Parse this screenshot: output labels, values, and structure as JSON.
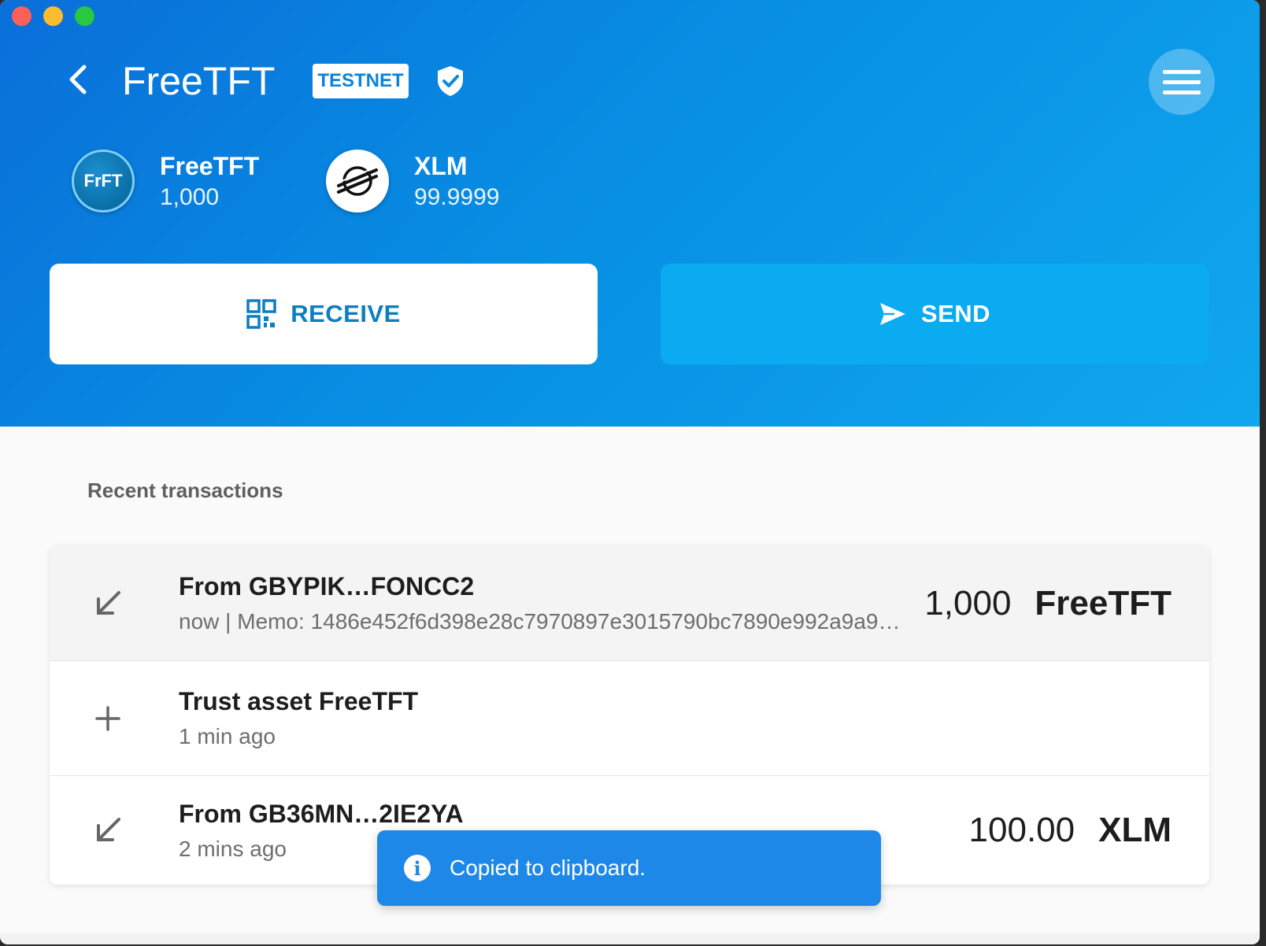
{
  "window": {
    "traffic_lights": [
      "close",
      "minimize",
      "maximize"
    ]
  },
  "header": {
    "title": "FreeTFT",
    "network_badge": "TESTNET",
    "back_icon": "chevron-left-icon",
    "verified_icon": "shield-check-icon",
    "menu_icon": "hamburger-icon"
  },
  "balances": [
    {
      "coin_label": "FrFT",
      "code": "FreeTFT",
      "amount": "1,000"
    },
    {
      "coin_label": "",
      "code": "XLM",
      "amount": "99.9999",
      "icon": "stellar-logo-icon"
    }
  ],
  "actions": {
    "receive_label": "RECEIVE",
    "receive_icon": "qr-code-icon",
    "send_label": "SEND",
    "send_icon": "send-icon"
  },
  "transactions": {
    "heading": "Recent transactions",
    "items": [
      {
        "icon": "arrow-down-left-icon",
        "title": "From GBYPIK…FONCC2",
        "subtitle": "now  |  Memo: 1486e452f6d398e28c7970897e3015790bc7890e992a9a9…",
        "amount": "1,000",
        "currency": "FreeTFT"
      },
      {
        "icon": "plus-icon",
        "title": "Trust asset FreeTFT",
        "subtitle": "1 min ago",
        "amount": "",
        "currency": ""
      },
      {
        "icon": "arrow-down-left-icon",
        "title": "From GB36MN…2IE2YA",
        "subtitle": "2 mins ago",
        "amount": "100.00",
        "currency": "XLM"
      }
    ]
  },
  "toast": {
    "icon": "info-icon",
    "message": "Copied to clipboard."
  },
  "colors": {
    "header_start": "#0a6fd9",
    "header_end": "#10a7ee",
    "send_button": "#0aabf0",
    "receive_text": "#0b7fc2",
    "toast": "#1e88e8"
  }
}
